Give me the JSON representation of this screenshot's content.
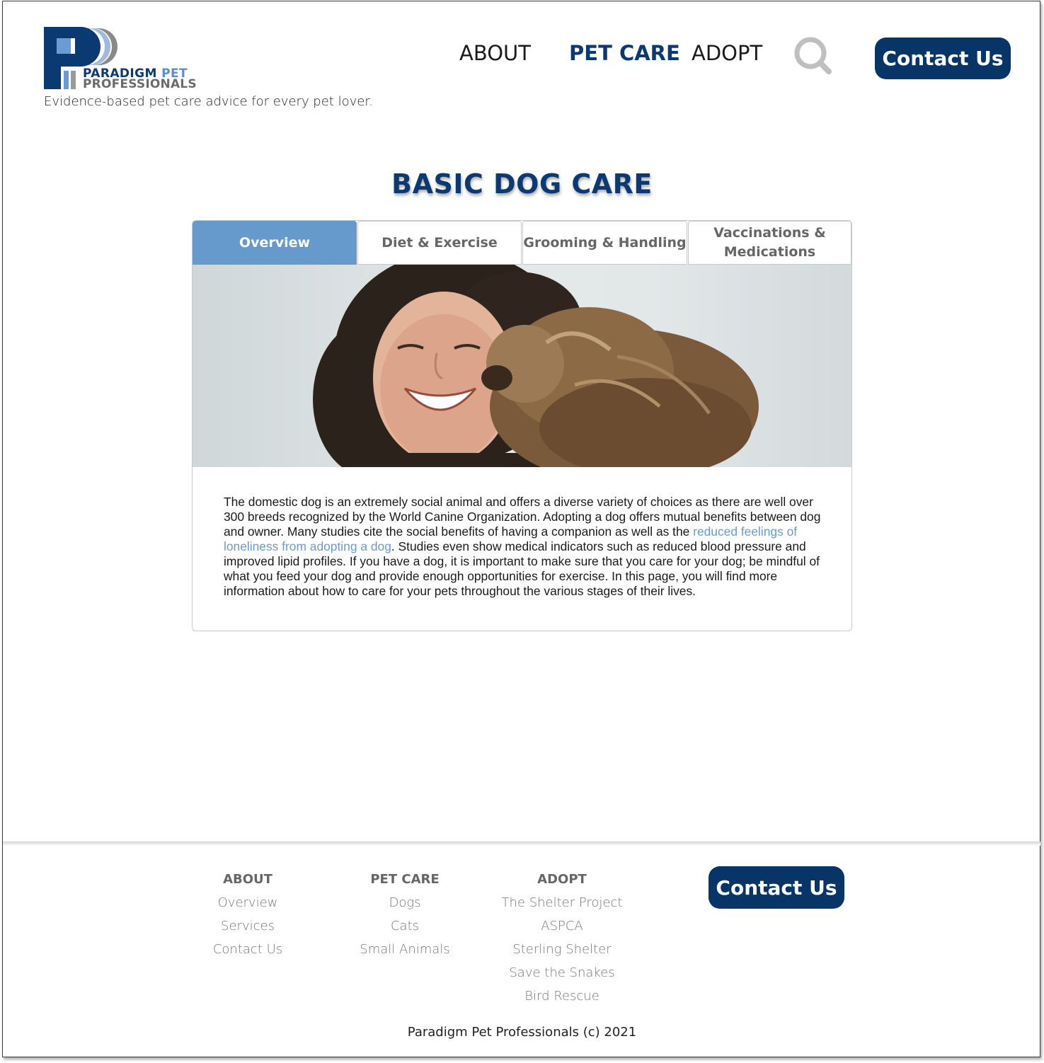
{
  "header": {
    "logo": {
      "line1_a": "PARADIGM",
      "line1_b": "PET",
      "line2": "PROFESSIONALS"
    },
    "tagline": "Evidence-based pet care advice for every pet lover.",
    "nav": {
      "about": "ABOUT",
      "pet_care": "PET CARE",
      "adopt": "ADOPT"
    },
    "contact_label": "Contact Us"
  },
  "main": {
    "title": "BASIC DOG CARE",
    "tabs": [
      {
        "label": "Overview"
      },
      {
        "label": "Diet & Exercise"
      },
      {
        "label": "Grooming & Handling"
      },
      {
        "label": "Vaccinations & Medications"
      }
    ],
    "active_tab": "Overview",
    "article": {
      "text_before_link": "The domestic dog is an extremely social animal and offers a diverse variety of choices as there are well over 300 breeds recognized by the World Canine Organization. Adopting a dog offers mutual benefits between dog and owner. Many studies cite the social benefits of having a companion as well as the ",
      "link_text": "reduced feelings of loneliness from adopting a dog",
      "text_after_link": ". Studies even show medical indicators such as reduced blood pressure and improved lipid profiles. If you have a dog, it is important to make sure that you care for your dog; be mindful of what you feed your dog and provide enough opportunities for exercise. In this page, you will find more information about how to care for your pets throughout the various stages of their lives."
    }
  },
  "footer": {
    "columns": [
      {
        "heading": "ABOUT",
        "links": [
          "Overview",
          "Services",
          "Contact Us"
        ]
      },
      {
        "heading": "PET CARE",
        "links": [
          "Dogs",
          "Cats",
          "Small Animals"
        ]
      },
      {
        "heading": "ADOPT",
        "links": [
          "The Shelter Project",
          "ASPCA",
          "Sterling Shelter",
          "Save the Snakes",
          "Bird Rescue"
        ]
      }
    ],
    "contact_label": "Contact Us",
    "copyright": "Paradigm Pet Professionals (c) 2021"
  },
  "colors": {
    "brand_navy": "#073568",
    "accent_blue": "#6699cc",
    "link_blue": "#6b9bd0",
    "footer_text": "#777777"
  },
  "icons": {
    "search": "search-icon",
    "logo": "paradigm-logo-icon"
  }
}
